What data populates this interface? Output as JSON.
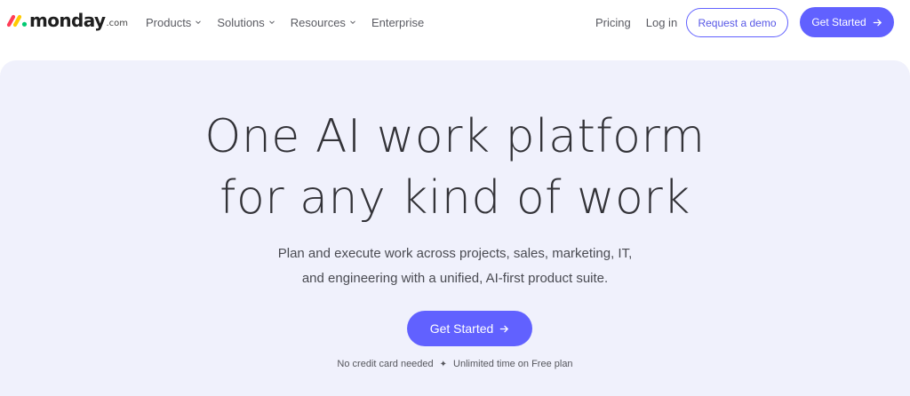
{
  "brand": {
    "name": "monday",
    "tld": ".com",
    "colors": [
      "#ff3d57",
      "#ffcb00",
      "#00ca72"
    ]
  },
  "nav": {
    "items": [
      {
        "label": "Products",
        "icon": "chevron-down-icon"
      },
      {
        "label": "Solutions",
        "icon": "chevron-down-icon"
      },
      {
        "label": "Resources",
        "icon": "chevron-down-icon"
      },
      {
        "label": "Enterprise"
      }
    ],
    "pricing": "Pricing",
    "login": "Log in",
    "demo_button": "Request a demo",
    "get_started_button": "Get Started"
  },
  "hero": {
    "title_line1": "One AI work platform",
    "title_line2": "for any kind of work",
    "subtitle_line1": "Plan and execute work across projects, sales, marketing, IT,",
    "subtitle_line2": "and engineering with a unified, AI-first product suite.",
    "cta": "Get Started",
    "note_left": "No credit card needed",
    "note_separator": "✦",
    "note_right": "Unlimited time on Free plan"
  },
  "colors": {
    "accent": "#6161ff",
    "hero_bg": "#f0f1fc"
  }
}
